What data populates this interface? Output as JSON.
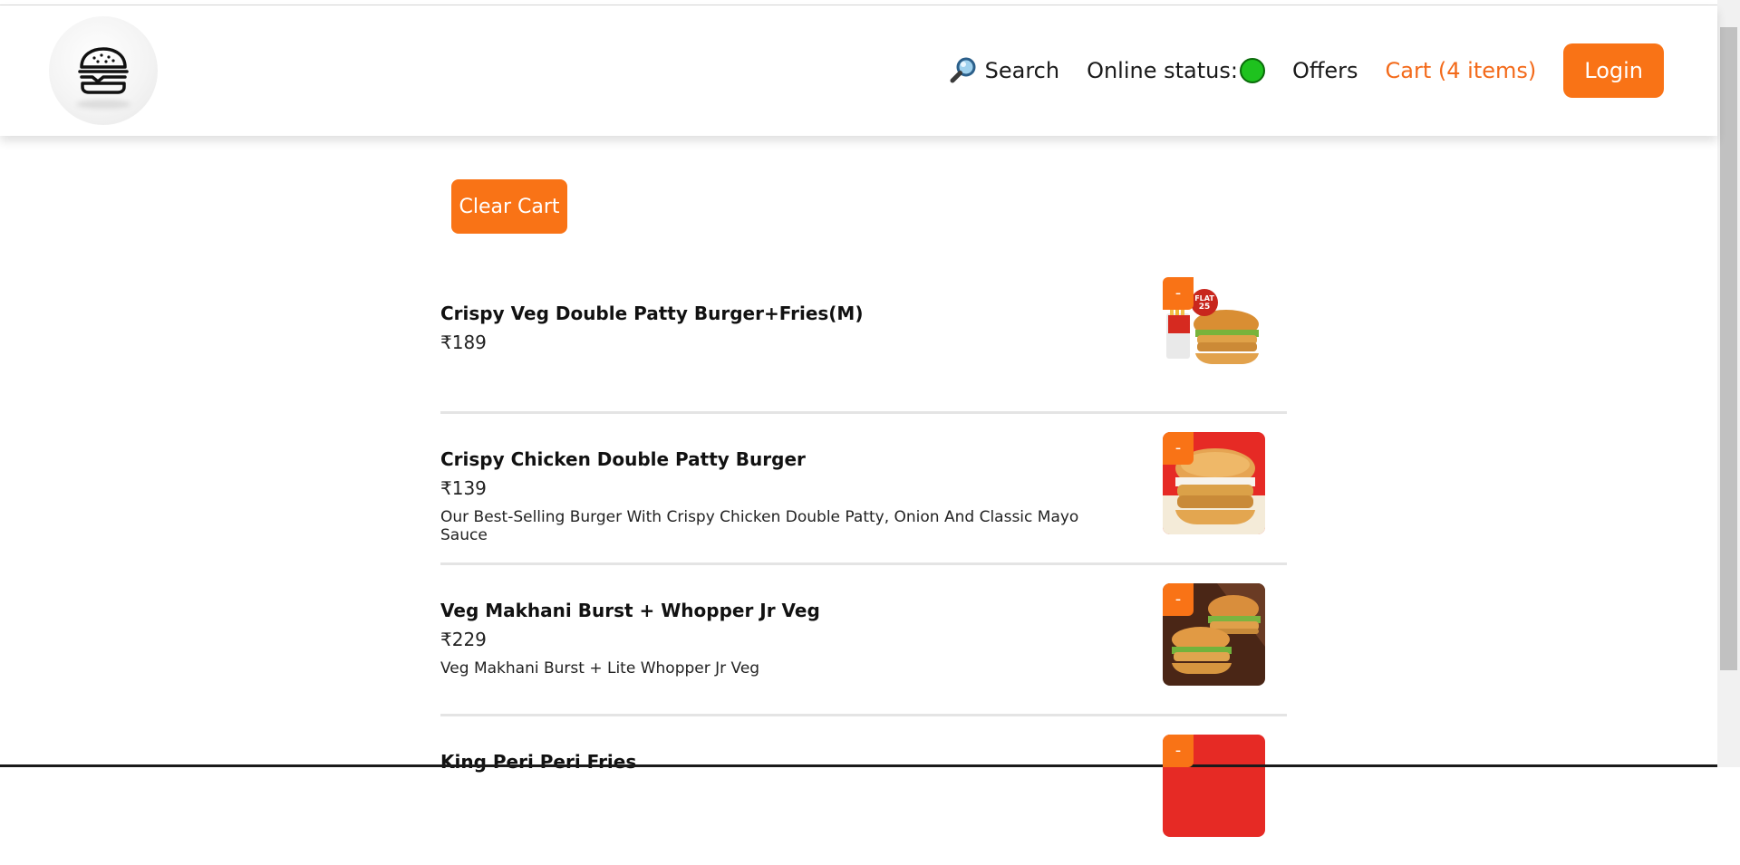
{
  "header": {
    "search_label": "Search",
    "online_status_label": "Online status:",
    "offers_label": "Offers",
    "cart_label": "Cart (4 items)",
    "login_label": "Login"
  },
  "clear_cart_label": "Clear Cart",
  "colors": {
    "accent": "#f97316",
    "cart_text": "#f36a1a",
    "online_dot": "#1ec21e"
  },
  "items": [
    {
      "name": "Crispy Veg Double Patty Burger+Fries(M)",
      "price": "₹189",
      "description": "",
      "remove_label": "-"
    },
    {
      "name": "Crispy Chicken Double Patty Burger",
      "price": "₹139",
      "description": "Our Best-Selling Burger With Crispy Chicken Double Patty, Onion And Classic Mayo Sauce",
      "remove_label": "-"
    },
    {
      "name": "Veg Makhani Burst + Whopper Jr Veg",
      "price": "₹229",
      "description": "Veg Makhani Burst + Lite Whopper Jr Veg",
      "remove_label": "-"
    },
    {
      "name": "King Peri Peri Fries",
      "price": "",
      "description": "",
      "remove_label": "-"
    }
  ]
}
